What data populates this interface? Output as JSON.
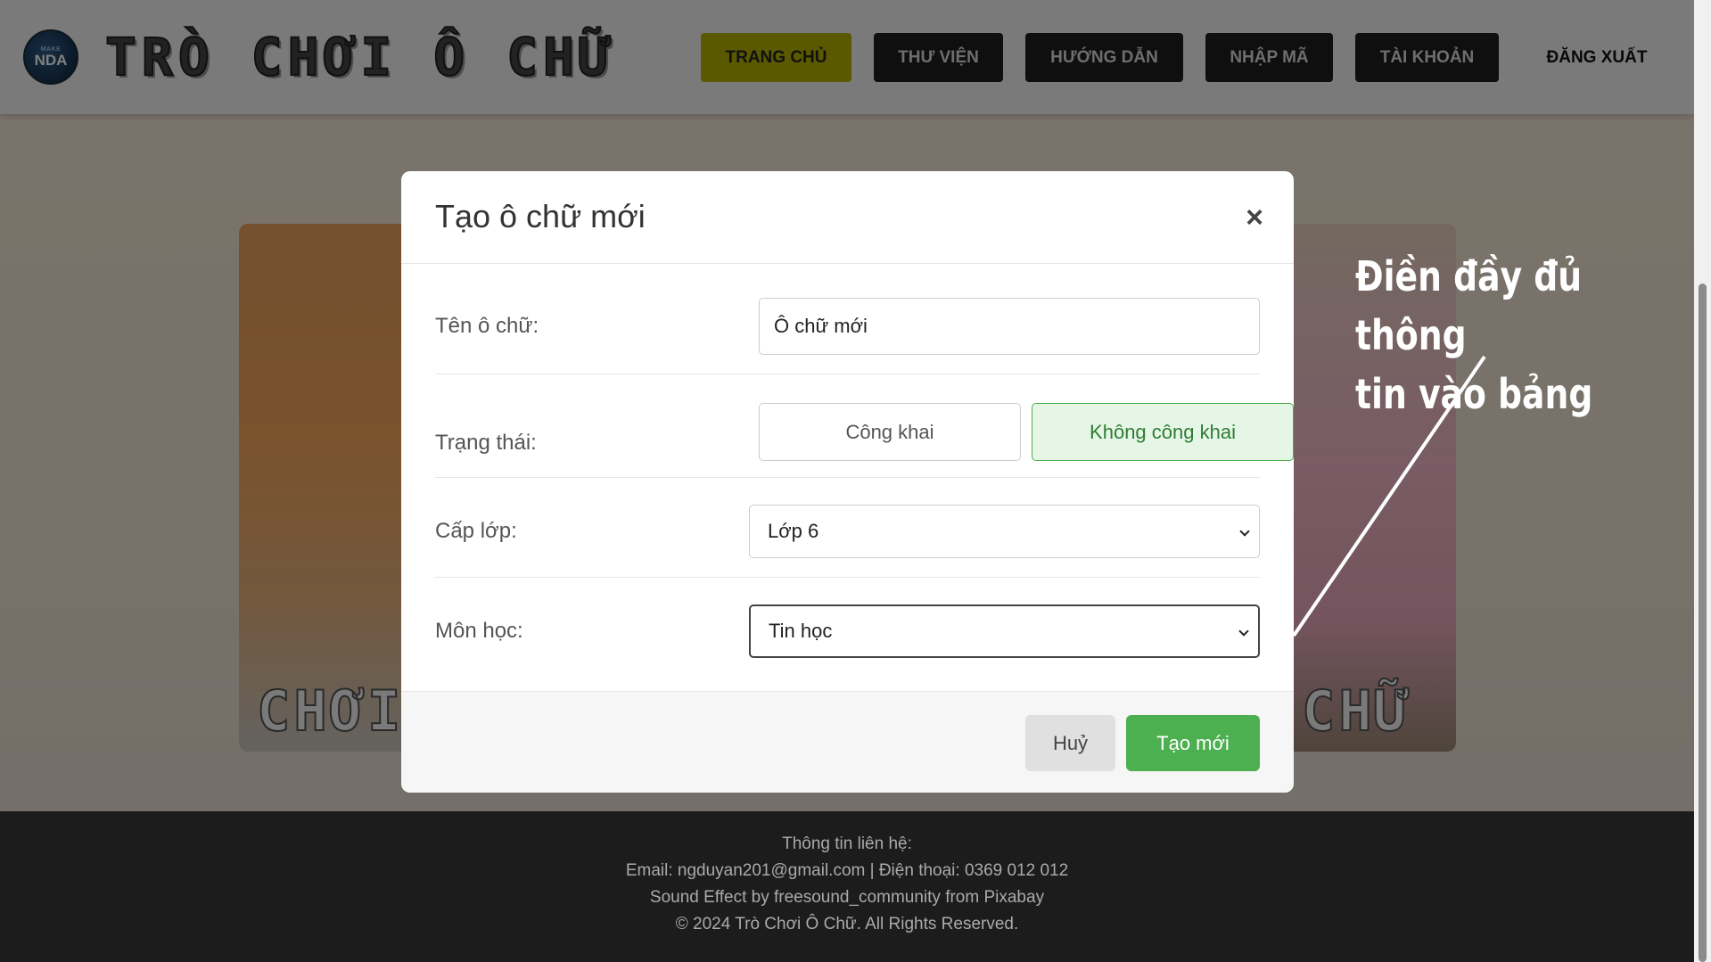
{
  "header": {
    "logo_small": "MAKE",
    "logo_text": "NDA",
    "site_title": "TRÒ CHƠI Ô CHỮ",
    "nav": [
      {
        "label": "TRANG CHỦ",
        "active": true
      },
      {
        "label": "THƯ VIỆN",
        "active": false
      },
      {
        "label": "HƯỚNG DẪN",
        "active": false
      },
      {
        "label": "NHẬP MÃ",
        "active": false
      },
      {
        "label": "TÀI KHOẢN",
        "active": false
      },
      {
        "label": "ĐĂNG XUẤT",
        "active": false
      }
    ]
  },
  "hero": {
    "left_word": "CHƠI",
    "right_word": "CHỮ"
  },
  "annotation": {
    "line1": "Điền đầy đủ thông",
    "line2": "tin vào bảng"
  },
  "modal": {
    "title": "Tạo ô chữ mới",
    "close_icon": "×",
    "fields": {
      "name_label": "Tên ô chữ:",
      "name_value": "Ô chữ mới",
      "status_label": "Trạng thái:",
      "status_public": "Công khai",
      "status_private": "Không công khai",
      "status_selected": "Không công khai",
      "grade_label": "Cấp lớp:",
      "grade_value": "Lớp 6",
      "subject_label": "Môn học:",
      "subject_value": "Tin học"
    },
    "cancel_label": "Huỷ",
    "create_label": "Tạo mới"
  },
  "footer": {
    "contact_title": "Thông tin liên hệ:",
    "contact_line": "Email: ngduyan201@gmail.com | Điện thoại: 0369 012 012",
    "credit": "Sound Effect by freesound_community from Pixabay",
    "copyright": "© 2024 Trò Chơi Ô Chữ. All Rights Reserved."
  },
  "colors": {
    "accent_active_nav": "#b7b300",
    "primary_green": "#4caf50",
    "footer_bg": "#1c1c1c"
  }
}
